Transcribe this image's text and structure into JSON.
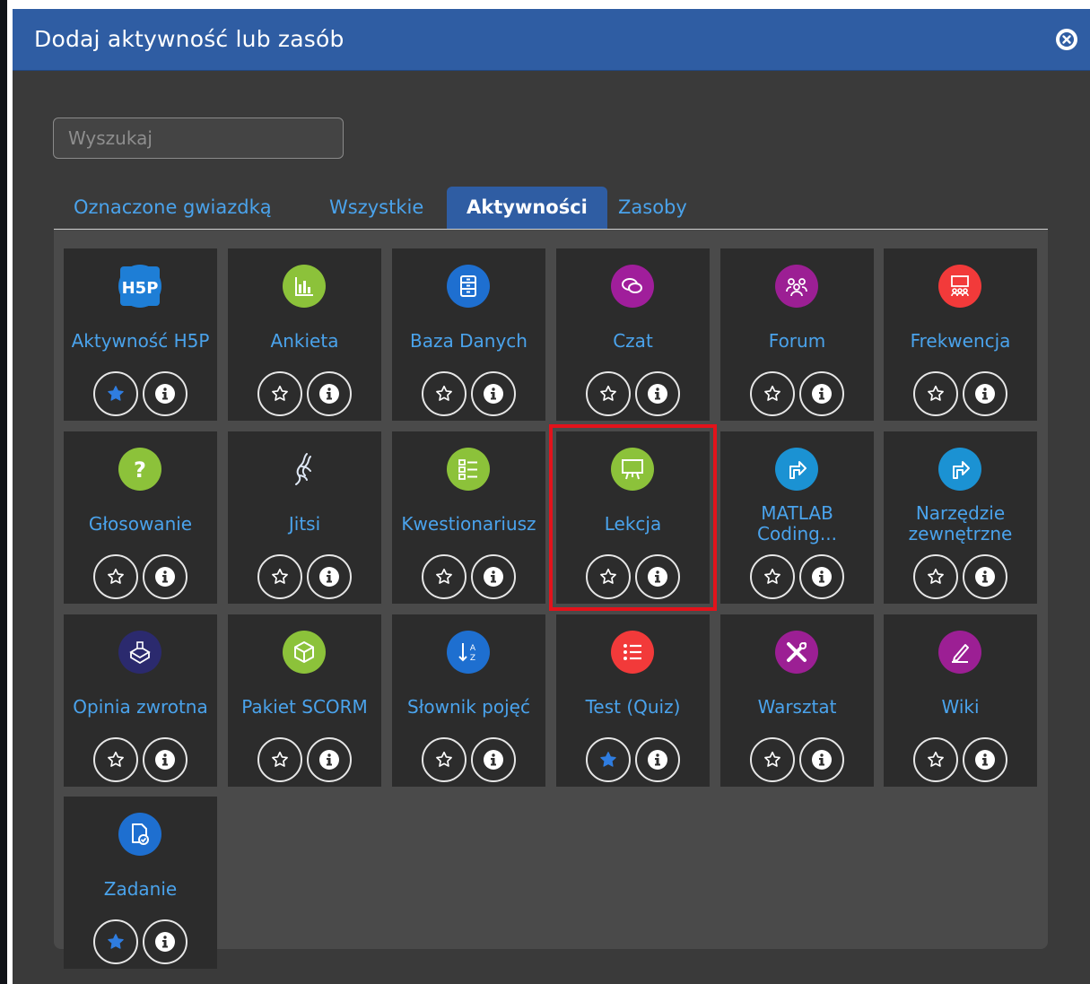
{
  "modal": {
    "title": "Dodaj aktywność lub zasób",
    "close_icon": "close-circle-icon"
  },
  "search": {
    "placeholder": "Wyszukaj",
    "value": ""
  },
  "tabs": [
    {
      "label": "Oznaczone gwiazdką",
      "active": false
    },
    {
      "label": "Wszystkie",
      "active": false
    },
    {
      "label": "Aktywności",
      "active": true
    },
    {
      "label": "Zasoby",
      "active": false
    }
  ],
  "colors": {
    "header": "#2f5da3",
    "link": "#4aa3ec",
    "highlight": "#e3131b"
  },
  "activities": [
    {
      "name": "Aktywność H5P",
      "icon": "h5p-icon",
      "color": "#1e7ed6",
      "starred": true
    },
    {
      "name": "Ankieta",
      "icon": "bar-chart-icon",
      "color": "#8cc23a",
      "starred": false
    },
    {
      "name": "Baza Danych",
      "icon": "database-cabinet-icon",
      "color": "#1e6fd0",
      "starred": false
    },
    {
      "name": "Czat",
      "icon": "chat-bubbles-icon",
      "color": "#a01e9b",
      "starred": false
    },
    {
      "name": "Forum",
      "icon": "people-group-icon",
      "color": "#9c1f94",
      "starred": false
    },
    {
      "name": "Frekwencja",
      "icon": "attendance-icon",
      "color": "#f23a3a",
      "starred": false
    },
    {
      "name": "Głosowanie",
      "icon": "question-mark-icon",
      "color": "#8cc23a",
      "starred": false
    },
    {
      "name": "Jitsi",
      "icon": "jitsi-logo-icon",
      "color": "transparent",
      "starred": false
    },
    {
      "name": "Kwestionariusz",
      "icon": "checklist-icon",
      "color": "#8cc23a",
      "starred": false
    },
    {
      "name": "Lekcja",
      "icon": "presentation-board-icon",
      "color": "#8cc23a",
      "starred": false,
      "highlighted": true
    },
    {
      "name": "MATLAB Coding...",
      "icon": "external-arrow-icon",
      "color": "#1b92d3",
      "starred": false
    },
    {
      "name": "Narzędzie zewnętrzne",
      "icon": "external-arrow-icon",
      "color": "#1b92d3",
      "starred": false
    },
    {
      "name": "Opinia zwrotna",
      "icon": "feedback-box-icon",
      "color": "#2b2a6e",
      "starred": false
    },
    {
      "name": "Pakiet SCORM",
      "icon": "scorm-cube-icon",
      "color": "#8cc23a",
      "starred": false
    },
    {
      "name": "Słownik pojęć",
      "icon": "sort-az-icon",
      "color": "#1e6fd0",
      "starred": false
    },
    {
      "name": "Test (Quiz)",
      "icon": "list-icon",
      "color": "#f23a3a",
      "starred": true
    },
    {
      "name": "Warsztat",
      "icon": "tools-icon",
      "color": "#9c1f94",
      "starred": false
    },
    {
      "name": "Wiki",
      "icon": "pencil-icon",
      "color": "#9c1f94",
      "starred": false
    },
    {
      "name": "Zadanie",
      "icon": "assignment-icon",
      "color": "#1e6fd0",
      "starred": true
    }
  ]
}
